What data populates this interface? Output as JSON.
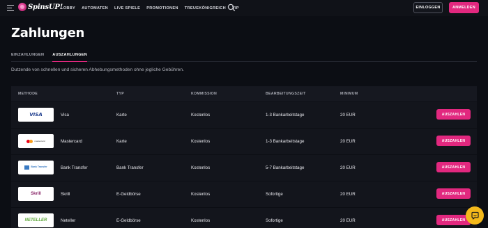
{
  "header": {
    "logo_text": "SpinsUP!",
    "nav": [
      "LOBBY",
      "AUTOMATEN",
      "LIVE SPIELE",
      "PROMOTIONEN",
      "TREUEKÖNIGREICH",
      "VIP"
    ],
    "login_label": "EINLOGGEN",
    "register_label": "ANMELDEN"
  },
  "page": {
    "title": "Zahlungen",
    "tabs": [
      "EINZAHLUNGEN",
      "AUSZAHLUNGEN"
    ],
    "active_tab": "AUSZAHLUNGEN",
    "subtitle": "Dutzende von schnellen und sicheren Abhebungsmethoden ohne jegliche Gebühren."
  },
  "table": {
    "columns": [
      "METHODE",
      "TYP",
      "KOMMISSION",
      "BEARBEITUNGSZEIT",
      "MINIMUM"
    ],
    "rows": [
      {
        "method": "Visa",
        "logo": "VISA",
        "type": "Karte",
        "commission": "Kostenlos",
        "time": "1-3 Bankarbeitstage",
        "minimum": "20 EUR",
        "action": "AUSZAHLEN"
      },
      {
        "method": "Mastercard",
        "logo": "mastercard",
        "type": "Karte",
        "commission": "Kostenlos",
        "time": "1-3 Bankarbeitstage",
        "minimum": "20 EUR",
        "action": "AUSZAHLEN"
      },
      {
        "method": "Bank Transfer",
        "logo": "Bank Transfer",
        "type": "Bank Transfer",
        "commission": "Kostenlos",
        "time": "5-7 Bankarbeitstage",
        "minimum": "20 EUR",
        "action": "AUSZAHLEN"
      },
      {
        "method": "Skrill",
        "logo": "Skrill",
        "type": "E-Geldbörse",
        "commission": "Kostenlos",
        "time": "Sofortige",
        "minimum": "20 EUR",
        "action": "AUSZAHLEN"
      },
      {
        "method": "Neteller",
        "logo": "NETELLER",
        "type": "E-Geldbörse",
        "commission": "Kostenlos",
        "time": "Sofortige",
        "minimum": "20 EUR",
        "action": "AUSZAHLEN"
      }
    ]
  },
  "colors": {
    "accent": "#e2287f",
    "background": "#0c0e14",
    "table_bg": "#13151c",
    "chat": "#f4b91b"
  },
  "icons": [
    "menu-icon",
    "search-icon",
    "chat-icon"
  ]
}
